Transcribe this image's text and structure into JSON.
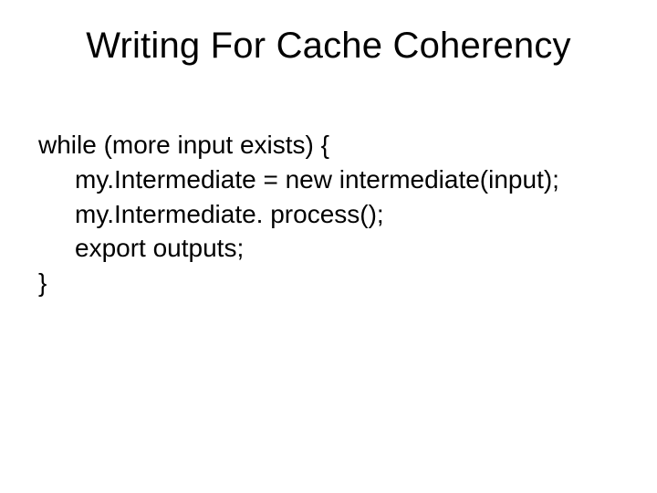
{
  "slide": {
    "title": "Writing For Cache Coherency",
    "code": {
      "line1": "while (more input exists) {",
      "line2": "my.Intermediate = new intermediate(input);",
      "line3": "my.Intermediate. process();",
      "line4": "export outputs;",
      "line5": "}"
    }
  }
}
